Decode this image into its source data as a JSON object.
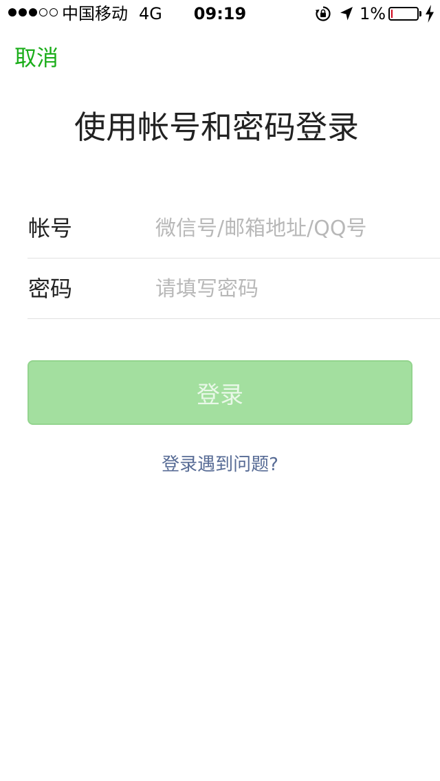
{
  "status_bar": {
    "carrier": "中国移动",
    "network": "4G",
    "time": "09:19",
    "battery_percent": "1%",
    "battery_level": 0.01,
    "signal_strength": 3,
    "signal_max": 5,
    "icons": [
      "rotation-lock-icon",
      "location-arrow-icon",
      "battery-icon",
      "charging-bolt-icon"
    ],
    "battery_low_color": "#d0021b"
  },
  "nav": {
    "cancel_label": "取消"
  },
  "page": {
    "title": "使用帐号和密码登录"
  },
  "form": {
    "account": {
      "label": "帐号",
      "value": "",
      "placeholder": "微信号/邮箱地址/QQ号"
    },
    "password": {
      "label": "密码",
      "value": "",
      "placeholder": "请填写密码"
    }
  },
  "actions": {
    "login_label": "登录",
    "help_label": "登录遇到问题?"
  },
  "colors": {
    "accent_green": "#1aad19",
    "button_disabled_bg": "#a3df9f",
    "link_blue": "#576b95",
    "placeholder_gray": "#b8b8b8"
  }
}
